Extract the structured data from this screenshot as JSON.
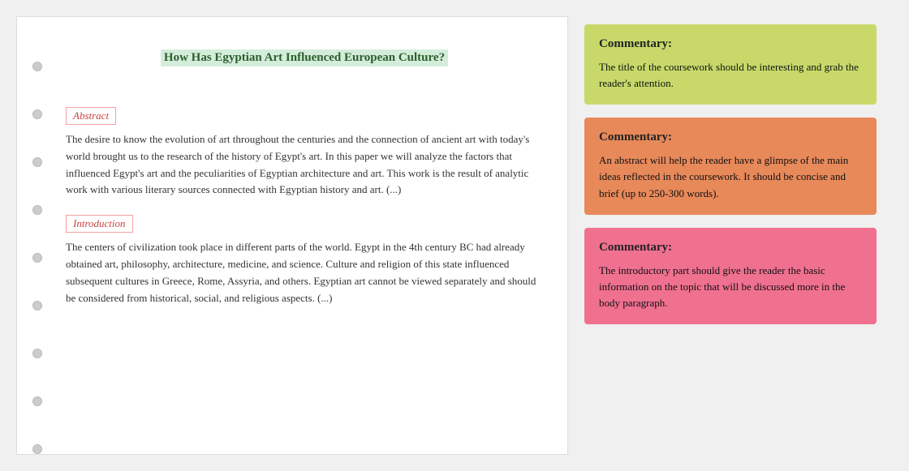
{
  "document": {
    "title": "How Has Egyptian Art Influenced European Culture?",
    "abstract_label": "Abstract",
    "abstract_text": "The desire to know the evolution of art throughout the centuries and the connection of ancient art with today's world brought us to the research of the history of Egypt's art. In this paper we will analyze the factors that influenced Egypt's art and the peculiarities of Egyptian architecture and art. This work is the result of analytic work with various literary sources connected with Egyptian history and art. (...)",
    "introduction_label": "Introduction",
    "introduction_text": "The centers of civilization took place in different parts of the world. Egypt in the 4th century BC had already obtained art, philosophy, architecture, medicine, and science. Culture and religion of this state influenced subsequent cultures in Greece, Rome, Assyria, and others. Egyptian art cannot be viewed separately and should be considered from historical, social, and religious aspects. (...)",
    "dot_count": 9
  },
  "commentaries": [
    {
      "id": "commentary-1",
      "title": "Commentary:",
      "text": "The title of the coursework should be interesting and grab the reader's attention.",
      "color": "green"
    },
    {
      "id": "commentary-2",
      "title": "Commentary:",
      "text": "An abstract will help the reader have a glimpse of the main ideas reflected in the coursework. It should be concise and brief (up to 250-300 words).",
      "color": "orange"
    },
    {
      "id": "commentary-3",
      "title": "Commentary:",
      "text": "The introductory part should give the reader the basic information on the topic that will be discussed more in the body paragraph.",
      "color": "pink"
    }
  ]
}
